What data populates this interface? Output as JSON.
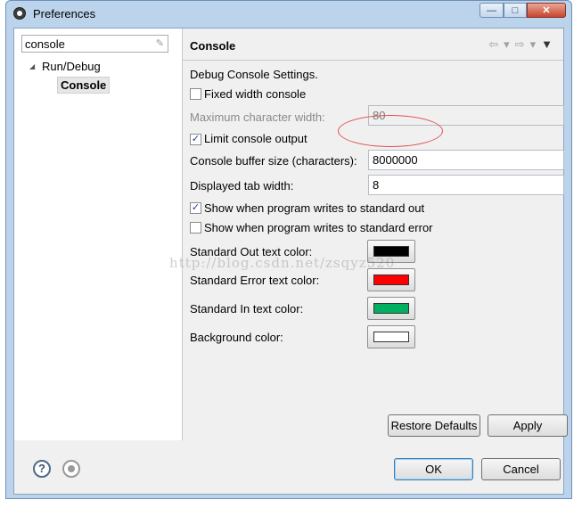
{
  "window": {
    "title": "Preferences",
    "close_glyph": "✕",
    "min_glyph": "—",
    "max_glyph": "□"
  },
  "filter": {
    "value": "console",
    "clear_glyph": "✎"
  },
  "tree": {
    "expand_glyph": "◢",
    "parent": "Run/Debug",
    "child": "Console"
  },
  "page": {
    "title": "Console",
    "nav_back": "⇦",
    "nav_forward": "⇨",
    "nav_drop": "▾",
    "nav_menu": "▼",
    "section_label": "Debug Console Settings.",
    "fixed_width": {
      "label": "Fixed width console",
      "checked": false
    },
    "max_width": {
      "label": "Maximum character width:",
      "value": "80"
    },
    "limit_output": {
      "label": "Limit console output",
      "checked": true
    },
    "buffer_size": {
      "label": "Console buffer size (characters):",
      "value": "8000000"
    },
    "tab_width": {
      "label": "Displayed tab width:",
      "value": "8"
    },
    "show_out": {
      "label": "Show when program writes to standard out",
      "checked": true
    },
    "show_err": {
      "label": "Show when program writes to standard error",
      "checked": false
    },
    "colors": [
      {
        "label": "Standard Out text color:",
        "color": "#000000"
      },
      {
        "label": "Standard Error text color:",
        "color": "#ff0000"
      },
      {
        "label": "Standard In text color:",
        "color": "#00b060"
      },
      {
        "label": "Background color:",
        "color": "#ffffff"
      }
    ],
    "restore_defaults": "Restore Defaults",
    "apply": "Apply"
  },
  "footer": {
    "help_glyph": "?",
    "ok": "OK",
    "cancel": "Cancel"
  },
  "watermark": "http://blog.csdn.net/zsqyz520",
  "check_glyph": "✓"
}
